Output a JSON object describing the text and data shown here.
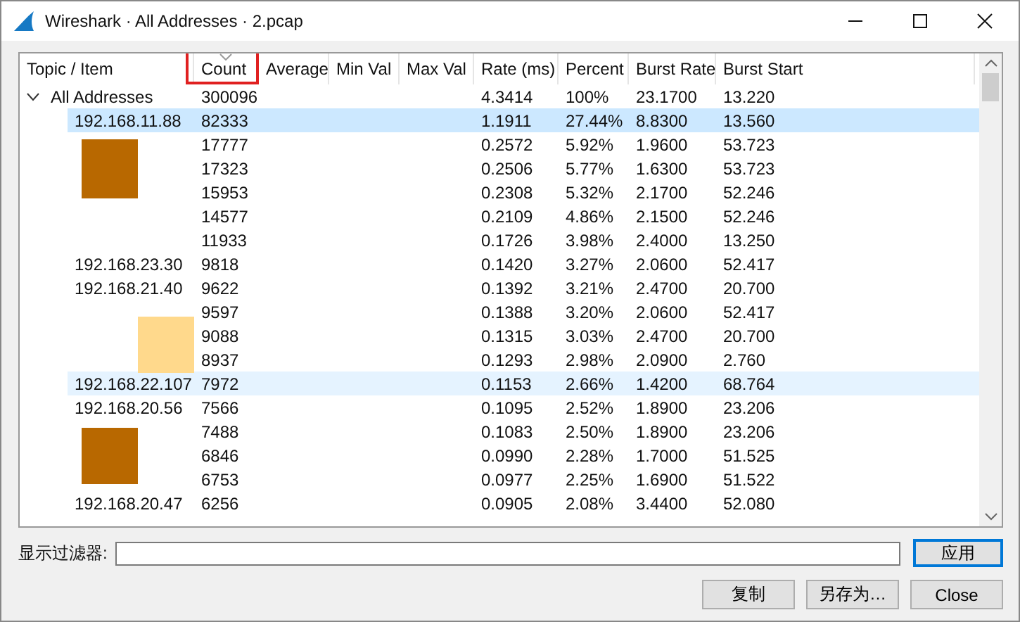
{
  "window": {
    "title": "Wireshark · All Addresses · 2.pcap"
  },
  "table": {
    "columns": [
      {
        "label": "Topic / Item",
        "sorted": false
      },
      {
        "label": "Count",
        "sorted": true
      },
      {
        "label": "Average",
        "sorted": false
      },
      {
        "label": "Min Val",
        "sorted": false
      },
      {
        "label": "Max Val",
        "sorted": false
      },
      {
        "label": "Rate (ms)",
        "sorted": false
      },
      {
        "label": "Percent",
        "sorted": false
      },
      {
        "label": "Burst Rate",
        "sorted": false
      },
      {
        "label": "Burst Start",
        "sorted": false
      }
    ],
    "root": {
      "item": "All Addresses",
      "expanded": true,
      "count": "300096",
      "rate": "4.3414",
      "percent": "100%",
      "burst_rate": "23.1700",
      "burst_start": "13.220",
      "children": [
        {
          "item": "192.168.11.88",
          "count": "82333",
          "rate": "1.1911",
          "percent": "27.44%",
          "burst_rate": "8.8300",
          "burst_start": "13.560",
          "selected": true,
          "hovered": false
        },
        {
          "count": "17777",
          "rate": "0.2572",
          "percent": "5.92%",
          "burst_rate": "1.9600",
          "burst_start": "53.723",
          "selected": false,
          "hovered": false
        },
        {
          "count": "17323",
          "rate": "0.2506",
          "percent": "5.77%",
          "burst_rate": "1.6300",
          "burst_start": "53.723",
          "selected": false,
          "hovered": false
        },
        {
          "count": "15953",
          "rate": "0.2308",
          "percent": "5.32%",
          "burst_rate": "2.1700",
          "burst_start": "52.246",
          "selected": false,
          "hovered": false
        },
        {
          "count": "14577",
          "rate": "0.2109",
          "percent": "4.86%",
          "burst_rate": "2.1500",
          "burst_start": "52.246",
          "selected": false,
          "hovered": false
        },
        {
          "count": "11933",
          "rate": "0.1726",
          "percent": "3.98%",
          "burst_rate": "2.4000",
          "burst_start": "13.250",
          "selected": false,
          "hovered": false
        },
        {
          "item": "192.168.23.30",
          "count": "9818",
          "rate": "0.1420",
          "percent": "3.27%",
          "burst_rate": "2.0600",
          "burst_start": "52.417",
          "selected": false,
          "hovered": false
        },
        {
          "item": "192.168.21.40",
          "count": "9622",
          "rate": "0.1392",
          "percent": "3.21%",
          "burst_rate": "2.4700",
          "burst_start": "20.700",
          "selected": false,
          "hovered": false
        },
        {
          "count": "9597",
          "rate": "0.1388",
          "percent": "3.20%",
          "burst_rate": "2.0600",
          "burst_start": "52.417",
          "selected": false,
          "hovered": false
        },
        {
          "count": "9088",
          "rate": "0.1315",
          "percent": "3.03%",
          "burst_rate": "2.4700",
          "burst_start": "20.700",
          "selected": false,
          "hovered": false
        },
        {
          "count": "8937",
          "rate": "0.1293",
          "percent": "2.98%",
          "burst_rate": "2.0900",
          "burst_start": "2.760",
          "selected": false,
          "hovered": false
        },
        {
          "item": "192.168.22.107",
          "count": "7972",
          "rate": "0.1153",
          "percent": "2.66%",
          "burst_rate": "1.4200",
          "burst_start": "68.764",
          "selected": false,
          "hovered": true
        },
        {
          "item": "192.168.20.56",
          "count": "7566",
          "rate": "0.1095",
          "percent": "2.52%",
          "burst_rate": "1.8900",
          "burst_start": "23.206",
          "selected": false,
          "hovered": false
        },
        {
          "count": "7488",
          "rate": "0.1083",
          "percent": "2.50%",
          "burst_rate": "1.8900",
          "burst_start": "23.206",
          "selected": false,
          "hovered": false
        },
        {
          "count": "6846",
          "rate": "0.0990",
          "percent": "2.28%",
          "burst_rate": "1.7000",
          "burst_start": "51.525",
          "selected": false,
          "hovered": false
        },
        {
          "count": "6753",
          "rate": "0.0977",
          "percent": "2.25%",
          "burst_rate": "1.6900",
          "burst_start": "51.522",
          "selected": false,
          "hovered": false
        },
        {
          "item": "192.168.20.47",
          "count": "6256",
          "rate": "0.0905",
          "percent": "2.08%",
          "burst_rate": "3.4400",
          "burst_start": "52.080",
          "selected": false,
          "hovered": false
        }
      ]
    }
  },
  "filter": {
    "label": "显示过滤器:",
    "apply_button": "应用"
  },
  "buttons": [
    "复制",
    "另存为…",
    "Close"
  ]
}
